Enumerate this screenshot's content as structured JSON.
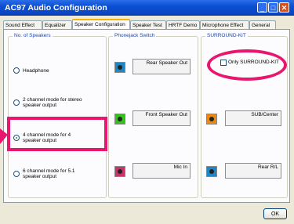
{
  "window": {
    "title": "AC97 Audio Configuration",
    "min": "_",
    "max": "□",
    "close": "✕"
  },
  "tabs": [
    "Sound Effect",
    "Equalizer",
    "Speaker Configuration",
    "Speaker Test",
    "HRTF Demo",
    "Microphone Effect",
    "General"
  ],
  "active_tab": "Speaker Configuration",
  "speakers_group": {
    "label": "No. of Speakers",
    "options": [
      {
        "label": "Headphone",
        "selected": false
      },
      {
        "label": "2 channel mode for stereo speaker output",
        "selected": false
      },
      {
        "label": "4 channel mode for 4 speaker output",
        "selected": true
      },
      {
        "label": "6 channel mode for 5.1 speaker output",
        "selected": false
      }
    ]
  },
  "phonejack_group": {
    "label": "Phonejack Switch",
    "jacks": [
      {
        "label": "Rear Speaker Out",
        "color": "#1f86c8"
      },
      {
        "label": "Front Speaker Out",
        "color": "#34c21a"
      },
      {
        "label": "Mic In",
        "color": "#c8336a"
      }
    ]
  },
  "surround_group": {
    "label": "SURROUND-KIT",
    "checkbox": {
      "label": "Only SURROUND-KIT",
      "checked": false
    },
    "jacks": [
      {
        "label": "SUB/Center",
        "color": "#e98b12"
      },
      {
        "label": "Rear R/L",
        "color": "#1f86c8"
      }
    ]
  },
  "ok_label": "OK",
  "highlight_color": "#e8166e"
}
